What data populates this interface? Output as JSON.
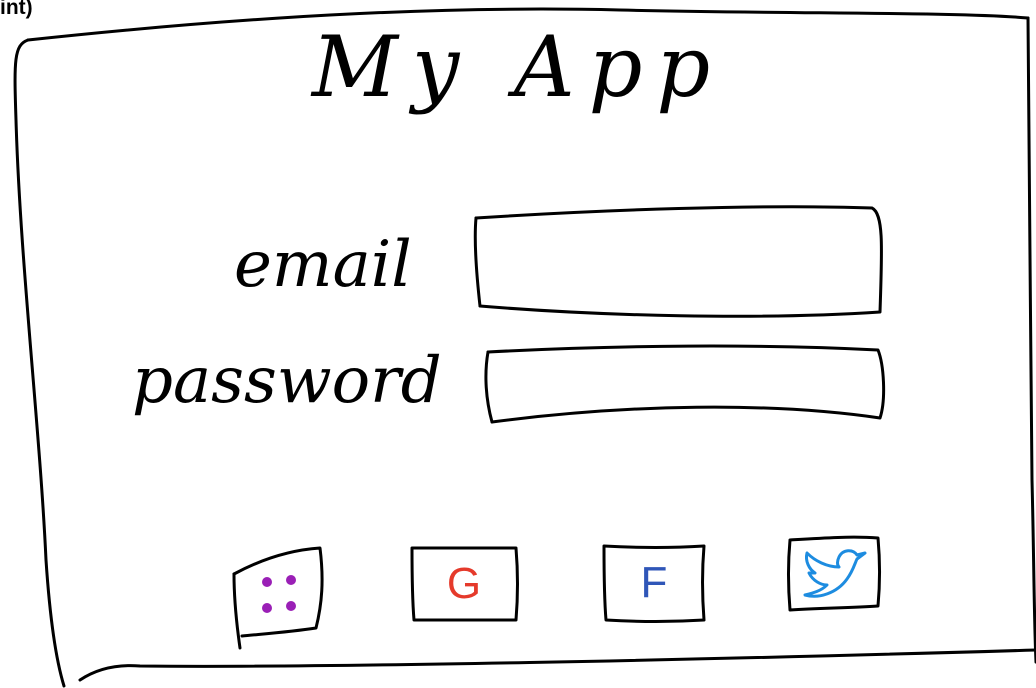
{
  "corner_label": "int)",
  "title": "My App",
  "form": {
    "email_label": "email",
    "email_value": "",
    "password_label": "password",
    "password_value": ""
  },
  "social": [
    {
      "name": "apps",
      "glyph": "",
      "icon": "four-dots-icon",
      "color": "#9a1fb6"
    },
    {
      "name": "google",
      "glyph": "G",
      "icon": "google-icon",
      "color": "#e53a2b"
    },
    {
      "name": "facebook",
      "glyph": "F",
      "icon": "facebook-icon",
      "color": "#2f56b8"
    },
    {
      "name": "twitter",
      "glyph": "",
      "icon": "twitter-bird-icon",
      "color": "#1d8ce0"
    }
  ]
}
